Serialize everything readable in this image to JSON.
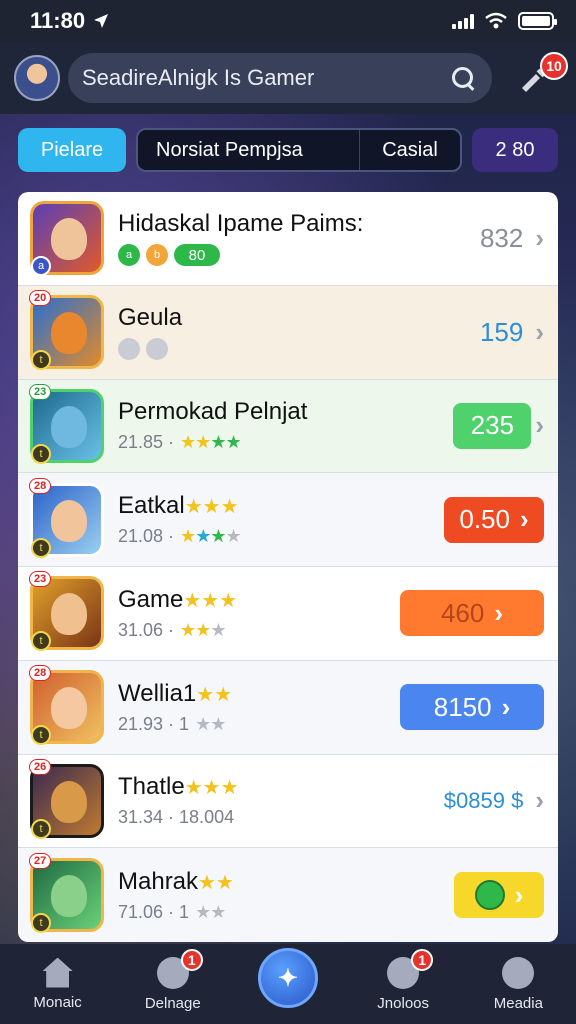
{
  "status_bar": {
    "time": "11:80"
  },
  "header": {
    "search_text": "SeadireAlnigk Is Gamer",
    "notification_count": "10"
  },
  "filters": {
    "active": "Pielare",
    "segment_one": "Norsiat Pempjsa",
    "segment_two": "Casial",
    "count": "2 80"
  },
  "games": [
    {
      "title": "Hidaskal Ipame Paims:",
      "price": "832",
      "tags": [
        "a",
        "b",
        "80"
      ],
      "style": "featured"
    },
    {
      "title": "Geula",
      "price": "159",
      "rank": "20",
      "corner": "t",
      "sub_style": "icons",
      "style": "tinted-a"
    },
    {
      "title": "Permokad Pelnjat",
      "subtitle": "21.85 ·",
      "price": "235",
      "rank": "23",
      "corner": "t",
      "style": "tinted-b"
    },
    {
      "title": "Eatkal",
      "subtitle": "21.08 ·",
      "price": "0.50",
      "rank": "28",
      "corner": "t",
      "style": "plain"
    },
    {
      "title": "Game",
      "subtitle": "31.06 ·",
      "price": "460",
      "rank": "23",
      "corner": "t",
      "style": "plain"
    },
    {
      "title": "Wellia1",
      "subtitle": "21.93 · 1",
      "price": "8150",
      "rank": "28",
      "corner": "t",
      "style": "plain"
    },
    {
      "title": "Thatle",
      "subtitle": "31.34 · 18.004",
      "price": "$0859 $",
      "rank": "26",
      "corner": "t",
      "style": "plain"
    },
    {
      "title": "Mahrak",
      "subtitle": "71.06 · 1",
      "price": "",
      "rank": "27",
      "corner": "t",
      "style": "plain"
    }
  ],
  "nav": {
    "items": [
      {
        "label": "Monaic",
        "icon": "home-icon"
      },
      {
        "label": "Delnage",
        "icon": "inbox-icon",
        "badge": "1"
      },
      {
        "label": "",
        "icon": "center-game-icon"
      },
      {
        "label": "Jnoloos",
        "icon": "friends-icon",
        "badge": "1"
      },
      {
        "label": "Meadia",
        "icon": "media-icon"
      }
    ]
  },
  "colors": {
    "accent_blue": "#2fb6ee",
    "price_green": "#4fd26b",
    "price_red": "#ef4b23",
    "price_orange": "#ff7a2e",
    "price_blue": "#4b86f0",
    "price_yellow": "#f7d82a",
    "badge_red": "#e5322c"
  }
}
